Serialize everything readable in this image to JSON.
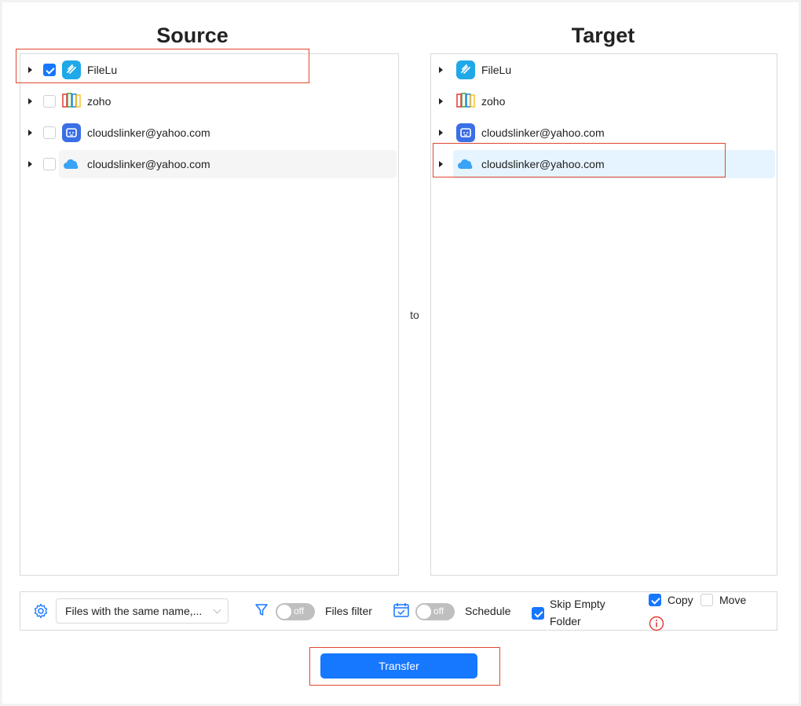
{
  "source": {
    "title": "Source",
    "items": [
      {
        "label": "FileLu",
        "icon": "filelu-icon",
        "checked": true
      },
      {
        "label": "zoho",
        "icon": "zoho-icon",
        "checked": false
      },
      {
        "label": "cloudslinker@yahoo.com",
        "icon": "box-bot-icon",
        "checked": false
      },
      {
        "label": "cloudslinker@yahoo.com",
        "icon": "icloud-icon",
        "checked": false
      }
    ]
  },
  "target": {
    "title": "Target",
    "items": [
      {
        "label": "FileLu",
        "icon": "filelu-icon"
      },
      {
        "label": "zoho",
        "icon": "zoho-icon"
      },
      {
        "label": "cloudslinker@yahoo.com",
        "icon": "box-bot-icon"
      },
      {
        "label": "cloudslinker@yahoo.com",
        "icon": "icloud-icon",
        "selected": true
      }
    ]
  },
  "connector_label": "to",
  "options": {
    "conflict_select": "Files with the same name,...",
    "files_filter": {
      "toggle": "off",
      "label": "Files filter"
    },
    "schedule": {
      "toggle": "off",
      "label": "Schedule"
    },
    "skip_empty": {
      "label_line1": "Skip Empty",
      "label_line2": "Folder",
      "checked": true
    },
    "copy": {
      "label": "Copy",
      "checked": true
    },
    "move": {
      "label": "Move",
      "checked": false
    }
  },
  "transfer_label": "Transfer",
  "colors": {
    "accent": "#1677ff",
    "highlight_border": "#e0472e",
    "info": "#e53935"
  }
}
